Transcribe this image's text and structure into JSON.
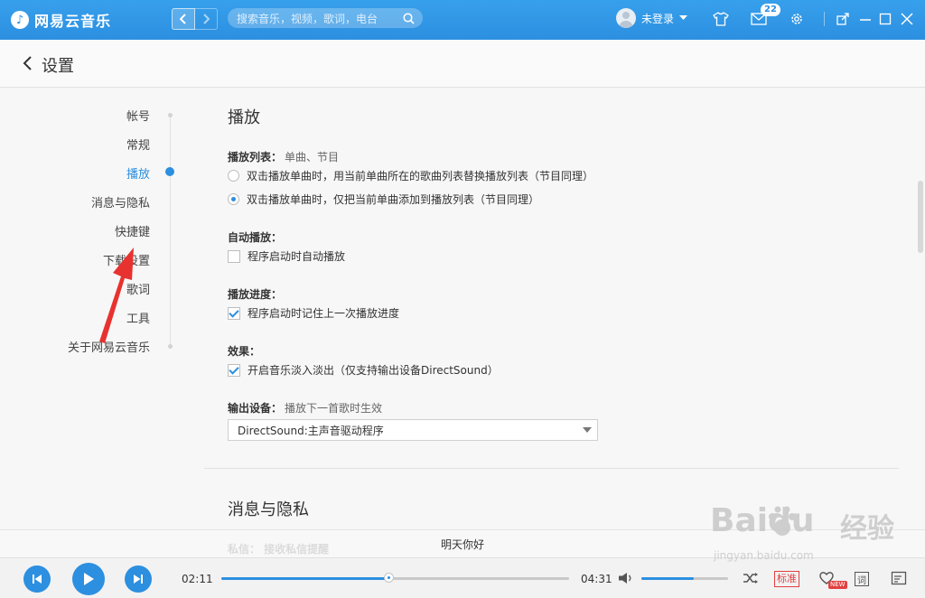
{
  "app": {
    "logo_glyph": "♪",
    "name": "网易云音乐"
  },
  "titlebar": {
    "search_placeholder": "搜索音乐，视频，歌词，电台",
    "user_name": "未登录",
    "message_count": "22",
    "icons": [
      "skin-icon",
      "mail-icon",
      "settings-icon",
      "mini-mode-icon",
      "minimize-icon",
      "maximize-icon",
      "close-icon"
    ],
    "accent_color": "#2c8fe0"
  },
  "header": {
    "title": "设置"
  },
  "sidenav": {
    "items": [
      {
        "label": "帐号"
      },
      {
        "label": "常规"
      },
      {
        "label": "播放",
        "active": true
      },
      {
        "label": "消息与隐私"
      },
      {
        "label": "快捷键"
      },
      {
        "label": "下载设置"
      },
      {
        "label": "歌词"
      },
      {
        "label": "工具"
      },
      {
        "label": "关于网易云音乐"
      }
    ]
  },
  "playback": {
    "title": "播放",
    "playlist": {
      "label": "播放列表：",
      "sub": "单曲、节目",
      "options": [
        {
          "label": "双击播放单曲时，用当前单曲所在的歌曲列表替换播放列表（节目同理）",
          "selected": false
        },
        {
          "label": "双击播放单曲时，仅把当前单曲添加到播放列表（节目同理）",
          "selected": true
        }
      ]
    },
    "autoplay": {
      "label": "自动播放：",
      "option": "程序启动时自动播放",
      "checked": false
    },
    "progress": {
      "label": "播放进度：",
      "option": "程序启动时记住上一次播放进度",
      "checked": true
    },
    "effects": {
      "label": "效果：",
      "option": "开启音乐淡入淡出（仅支持输出设备DirectSound）",
      "checked": true
    },
    "output": {
      "label": "输出设备：",
      "sub": "播放下一首歌时生效",
      "value": "DirectSound:主声音驱动程序"
    }
  },
  "privacy": {
    "title": "消息与隐私",
    "faded_label": "私信：  接收私信提醒"
  },
  "player": {
    "song_title": "明天你好",
    "elapsed": "02:11",
    "duration": "04:31",
    "progress_fraction": 0.48,
    "volume_fraction": 0.6,
    "quality_label": "标准",
    "new_tag": "NEW",
    "lyric_label": "词"
  },
  "watermark": {
    "brand": "Baidu",
    "brand_cn": "经验",
    "url": "jingyan.baidu.com"
  }
}
